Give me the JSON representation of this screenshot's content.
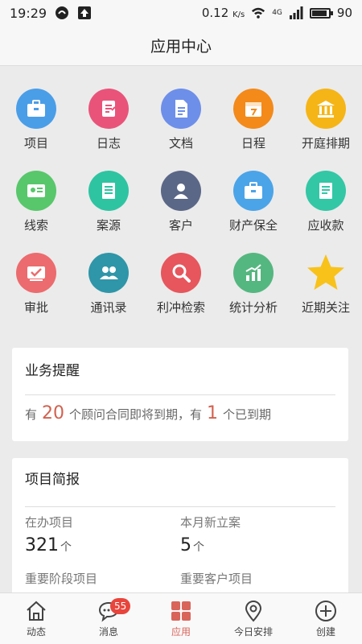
{
  "status_bar": {
    "time": "19:29",
    "speed": "0.12",
    "speed_unit": "K/s",
    "network": "4G",
    "battery": "90"
  },
  "header": {
    "title": "应用中心"
  },
  "apps": [
    {
      "label": "项目",
      "icon": "briefcase-icon",
      "color": "#4a9ee8"
    },
    {
      "label": "日志",
      "icon": "notebook-icon",
      "color": "#e9537a"
    },
    {
      "label": "文档",
      "icon": "document-icon",
      "color": "#6d8fea"
    },
    {
      "label": "日程",
      "icon": "calendar-icon",
      "color": "#f38a1a"
    },
    {
      "label": "开庭排期",
      "icon": "courthouse-icon",
      "color": "#f6b517"
    },
    {
      "label": "线索",
      "icon": "id-card-icon",
      "color": "#58c76b"
    },
    {
      "label": "案源",
      "icon": "list-doc-icon",
      "color": "#2ec4a2"
    },
    {
      "label": "客户",
      "icon": "person-icon",
      "color": "#5b6787"
    },
    {
      "label": "财产保全",
      "icon": "briefcase-icon",
      "color": "#4ba4e8"
    },
    {
      "label": "应收款",
      "icon": "receipt-icon",
      "color": "#33c7a6"
    },
    {
      "label": "审批",
      "icon": "approval-icon",
      "color": "#ec6b6e"
    },
    {
      "label": "通讯录",
      "icon": "contacts-icon",
      "color": "#2e96a8"
    },
    {
      "label": "利冲检索",
      "icon": "magnifier-icon",
      "color": "#e6565c"
    },
    {
      "label": "统计分析",
      "icon": "growth-chart-icon",
      "color": "#55b780"
    },
    {
      "label": "近期关注",
      "icon": "star-icon",
      "color": "#f8c21b"
    }
  ],
  "reminder": {
    "title": "业务提醒",
    "prefix": "有",
    "count1": "20",
    "middle": "个顾问合同即将到期，有",
    "count2": "1",
    "suffix": "个已到期"
  },
  "brief": {
    "title": "项目简报",
    "stats": [
      {
        "label": "在办项目",
        "value": "321",
        "unit": "个"
      },
      {
        "label": "本月新立案",
        "value": "5",
        "unit": "个"
      },
      {
        "label": "重要阶段项目",
        "value": "",
        "unit": ""
      },
      {
        "label": "重要客户项目",
        "value": "",
        "unit": ""
      }
    ]
  },
  "tabs": [
    {
      "label": "动态",
      "icon": "home-icon"
    },
    {
      "label": "消息",
      "icon": "chat-icon",
      "badge": "55"
    },
    {
      "label": "应用",
      "icon": "grid-icon",
      "active": true
    },
    {
      "label": "今日安排",
      "icon": "location-pin-icon"
    },
    {
      "label": "创建",
      "icon": "add-circle-icon"
    }
  ]
}
